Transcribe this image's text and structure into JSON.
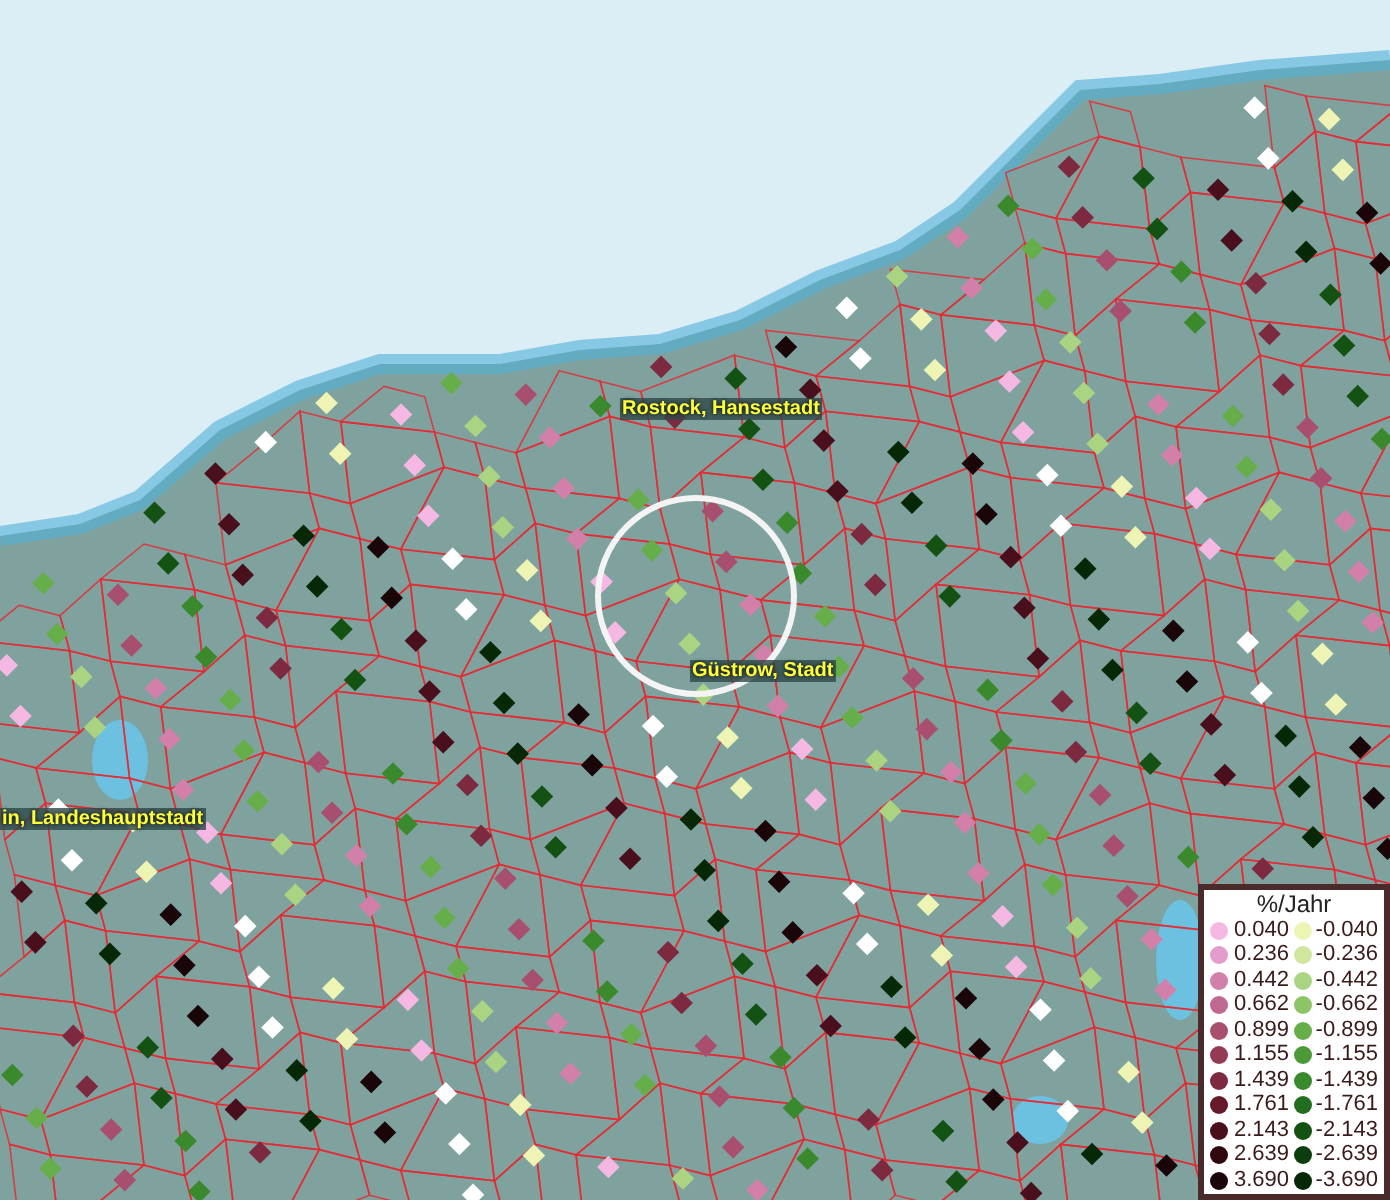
{
  "map": {
    "places": [
      {
        "name": "Rostock, Hansestadt"
      },
      {
        "name": "Güstrow, Stadt"
      },
      {
        "name": "in, Landeshauptstadt"
      }
    ]
  },
  "legend": {
    "title": "%/Jahr",
    "rows": [
      {
        "left": {
          "value": "0.040",
          "color": "#f4b8e2"
        },
        "right": {
          "value": "-0.040",
          "color": "#eef4b4"
        }
      },
      {
        "left": {
          "value": "0.236",
          "color": "#e39ccb"
        },
        "right": {
          "value": "-0.236",
          "color": "#cfe69c"
        }
      },
      {
        "left": {
          "value": "0.442",
          "color": "#d280aa"
        },
        "right": {
          "value": "-0.442",
          "color": "#abd482"
        }
      },
      {
        "left": {
          "value": "0.662",
          "color": "#bf6890"
        },
        "right": {
          "value": "-0.662",
          "color": "#8cc466"
        }
      },
      {
        "left": {
          "value": "0.899",
          "color": "#a84f6f"
        },
        "right": {
          "value": "-0.899",
          "color": "#66ae4a"
        }
      },
      {
        "left": {
          "value": "1.155",
          "color": "#943a55"
        },
        "right": {
          "value": "-1.155",
          "color": "#4b9a37"
        }
      },
      {
        "left": {
          "value": "1.439",
          "color": "#7d2a40"
        },
        "right": {
          "value": "-1.439",
          "color": "#3a892c"
        }
      },
      {
        "left": {
          "value": "1.761",
          "color": "#651a2c"
        },
        "right": {
          "value": "-1.761",
          "color": "#236e1e"
        }
      },
      {
        "left": {
          "value": "2.143",
          "color": "#4a0f1c"
        },
        "right": {
          "value": "-2.143",
          "color": "#145214"
        }
      },
      {
        "left": {
          "value": "2.639",
          "color": "#300810"
        },
        "right": {
          "value": "-2.639",
          "color": "#0c3d0c"
        }
      },
      {
        "left": {
          "value": "3.690",
          "color": "#1a0508"
        },
        "right": {
          "value": "-3.690",
          "color": "#062806"
        }
      }
    ]
  }
}
